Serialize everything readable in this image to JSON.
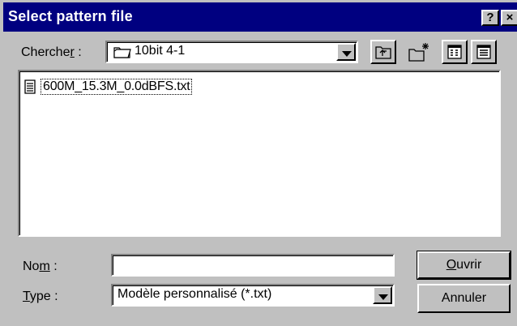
{
  "window": {
    "title": "Select pattern file",
    "help_button": "?",
    "close_button": "×"
  },
  "lookin": {
    "label_pre": "Cherche",
    "label_mnemonic": "r",
    "label_post": " :",
    "folder": "10bit 4-1"
  },
  "toolbar": {
    "icons": [
      "up-one-level-icon",
      "new-folder-icon",
      "list-view-icon",
      "details-view-icon"
    ]
  },
  "files": [
    {
      "name": "600M_15.3M_0.0dBFS.txt",
      "icon": "text-file-icon"
    }
  ],
  "name_field": {
    "label_pre": "No",
    "label_mnemonic": "m",
    "label_post": " :",
    "value": ""
  },
  "type_field": {
    "label_mnemonic": "T",
    "label_post": "ype :",
    "selected": "Modèle personnalisé (*.txt)"
  },
  "buttons": {
    "open_mnemonic": "O",
    "open_rest": "uvrir",
    "cancel": "Annuler"
  }
}
